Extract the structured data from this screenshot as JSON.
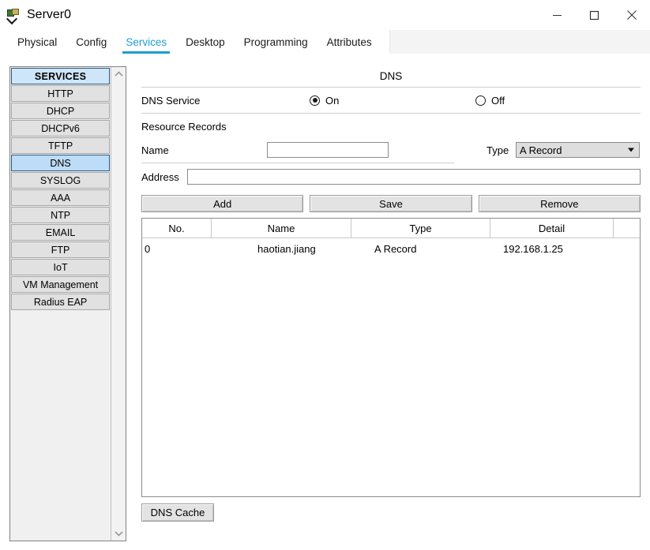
{
  "window": {
    "title": "Server0",
    "icon": "packet-tracer-device-icon",
    "controls": {
      "minimize": "minimize-icon",
      "maximize": "maximize-icon",
      "close": "close-icon"
    }
  },
  "tabs": [
    {
      "label": "Physical",
      "active": false
    },
    {
      "label": "Config",
      "active": false
    },
    {
      "label": "Services",
      "active": true
    },
    {
      "label": "Desktop",
      "active": false
    },
    {
      "label": "Programming",
      "active": false
    },
    {
      "label": "Attributes",
      "active": false
    }
  ],
  "sidebar": {
    "scroll": {
      "up": "chevron-up-icon",
      "down": "chevron-down-icon"
    },
    "items": [
      {
        "label": "SERVICES",
        "state": "header"
      },
      {
        "label": "HTTP",
        "state": "normal"
      },
      {
        "label": "DHCP",
        "state": "normal"
      },
      {
        "label": "DHCPv6",
        "state": "normal"
      },
      {
        "label": "TFTP",
        "state": "normal"
      },
      {
        "label": "DNS",
        "state": "selected"
      },
      {
        "label": "SYSLOG",
        "state": "normal"
      },
      {
        "label": "AAA",
        "state": "normal"
      },
      {
        "label": "NTP",
        "state": "normal"
      },
      {
        "label": "EMAIL",
        "state": "normal"
      },
      {
        "label": "FTP",
        "state": "normal"
      },
      {
        "label": "IoT",
        "state": "normal"
      },
      {
        "label": "VM Management",
        "state": "normal"
      },
      {
        "label": "Radius EAP",
        "state": "normal"
      }
    ]
  },
  "panel": {
    "title": "DNS",
    "service": {
      "label": "DNS Service",
      "on_label": "On",
      "off_label": "Off",
      "selected": "On"
    },
    "resource_records": {
      "section_label": "Resource Records",
      "name_label": "Name",
      "name_value": "",
      "name_placeholder": "",
      "type_label": "Type",
      "type_value": "A Record",
      "address_label": "Address",
      "address_value": "",
      "address_placeholder": ""
    },
    "buttons": {
      "add": "Add",
      "save": "Save",
      "remove": "Remove",
      "dns_cache": "DNS Cache"
    },
    "table": {
      "columns": [
        "No.",
        "Name",
        "Type",
        "Detail"
      ],
      "rows": [
        {
          "no": "0",
          "name": "haotian.jiang",
          "type": "A Record",
          "detail": "192.168.1.25"
        }
      ]
    }
  },
  "colors": {
    "accent": "#1f9cd4",
    "selection": "#bddcf7",
    "header_selection": "#cfe5f8",
    "button_face": "#e3e3e3",
    "item_face": "#e1e1e1"
  }
}
